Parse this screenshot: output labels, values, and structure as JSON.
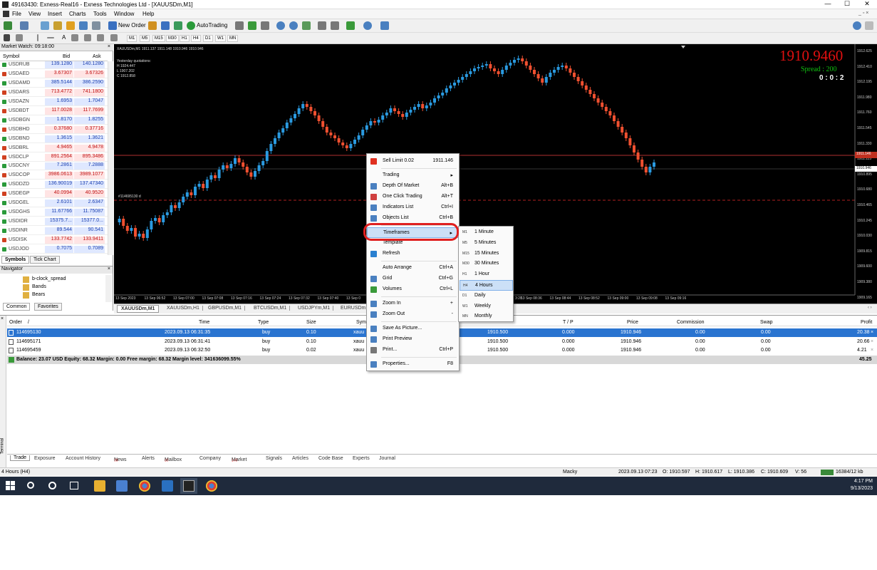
{
  "titlebar": {
    "title": "49163430: Exness-Real16 - Exness Technologies Ltd - [XAUUSDm,M1]",
    "min": "—",
    "max": "☐",
    "close": "✕"
  },
  "menu": [
    "File",
    "View",
    "Insert",
    "Charts",
    "Tools",
    "Window",
    "Help"
  ],
  "toolbar": {
    "new_order": "New Order",
    "autotrading": "AutoTrading"
  },
  "timeframes": [
    "M1",
    "M5",
    "M15",
    "M30",
    "H1",
    "H4",
    "D1",
    "W1",
    "MN"
  ],
  "market_watch": {
    "header": "Market Watch: 09:18:00",
    "col_symbol": "Symbol",
    "col_bid": "Bid",
    "col_ask": "Ask",
    "rows": [
      {
        "sym": "USDRUB",
        "bid": "139.1280",
        "ask": "140.1280",
        "dir": "up"
      },
      {
        "sym": "USDAED",
        "bid": "3.67307",
        "ask": "3.67326",
        "dir": "down"
      },
      {
        "sym": "USDAMD",
        "bid": "385.5144",
        "ask": "386.2590",
        "dir": "up"
      },
      {
        "sym": "USDARS",
        "bid": "713.4772",
        "ask": "741.1800",
        "dir": "down"
      },
      {
        "sym": "USDAZN",
        "bid": "1.6953",
        "ask": "1.7047",
        "dir": "up"
      },
      {
        "sym": "USDBDT",
        "bid": "117.0028",
        "ask": "117.7699",
        "dir": "down"
      },
      {
        "sym": "USDBGN",
        "bid": "1.8170",
        "ask": "1.8255",
        "dir": "up"
      },
      {
        "sym": "USDBHD",
        "bid": "0.37680",
        "ask": "0.37716",
        "dir": "down"
      },
      {
        "sym": "USDBND",
        "bid": "1.3615",
        "ask": "1.3621",
        "dir": "up"
      },
      {
        "sym": "USDBRL",
        "bid": "4.9465",
        "ask": "4.9478",
        "dir": "down"
      },
      {
        "sym": "USDCLP",
        "bid": "891.2564",
        "ask": "895.3486",
        "dir": "down"
      },
      {
        "sym": "USDCNY",
        "bid": "7.2861",
        "ask": "7.2888",
        "dir": "up"
      },
      {
        "sym": "USDCOP",
        "bid": "3986.0613",
        "ask": "3989.1077",
        "dir": "down"
      },
      {
        "sym": "USDDZD",
        "bid": "136.90019",
        "ask": "137.47340",
        "dir": "up"
      },
      {
        "sym": "USDEGP",
        "bid": "40.0994",
        "ask": "40.9520",
        "dir": "down"
      },
      {
        "sym": "USDGEL",
        "bid": "2.6101",
        "ask": "2.6347",
        "dir": "up"
      },
      {
        "sym": "USDGHS",
        "bid": "11.67766",
        "ask": "11.75087",
        "dir": "up"
      },
      {
        "sym": "USDIDR",
        "bid": "15375.7...",
        "ask": "15377.0...",
        "dir": "up"
      },
      {
        "sym": "USDINR",
        "bid": "89.544",
        "ask": "90.541",
        "dir": "up"
      },
      {
        "sym": "USDISK",
        "bid": "133.7742",
        "ask": "133.9411",
        "dir": "down"
      },
      {
        "sym": "USDJOD",
        "bid": "0.7075",
        "ask": "0.7089",
        "dir": "up"
      }
    ],
    "tab_symbols": "Symbols",
    "tab_tick": "Tick Chart"
  },
  "navigator": {
    "header": "Navigator",
    "items": [
      "b-clock_spread",
      "Bands",
      "Bears"
    ],
    "tab_common": "Common",
    "tab_favorites": "Favorites"
  },
  "chart": {
    "header": "XAUUSDm,M1  1911.137 1911.148 1910.946 1910.946",
    "yq": "Yesterday quotations:",
    "h": "H 1924.447",
    "l": "L 1907.202",
    "c": "C 1912.858",
    "big_price": "1910.9460",
    "spread": "Spread : 200",
    "timer": "0 : 0 : 2",
    "order_label": "#114695130 d",
    "price_axis": [
      "1912.625",
      "1912.410",
      "1912.195",
      "1911.980",
      "1911.760",
      "1911.545",
      "1911.330",
      "1911.115",
      "1910.895",
      "1910.680",
      "1910.465",
      "1910.245",
      "1910.030",
      "1909.815",
      "1909.600",
      "1909.380",
      "1909.165"
    ],
    "ask_line": "1911.146",
    "bid_line": "1910.946",
    "time_axis_left": [
      "13 Sep 2023",
      "13 Sep 06:52",
      "13 Sep 07:00",
      "13 Sep 07:08",
      "13 Sep 07:16",
      "13 Sep 07:24",
      "13 Sep 07:32",
      "13 Sep 07:40",
      "13 Sep 0"
    ],
    "time_axis_right": [
      "3:28",
      "13 Sep 08:36",
      "13 Sep 08:44",
      "13 Sep 08:52",
      "13 Sep 09:00",
      "13 Sep 09:08",
      "13 Sep 09:16"
    ]
  },
  "chart_tabs": [
    "XAUUSDm,M1",
    "XAUUSDm,H1",
    "GBPUSDm,M1",
    "BTCUSDm,M1",
    "USDJPYm,M1",
    "EURUSDm,"
  ],
  "context_menu": [
    {
      "label": "Sell Limit 0.02",
      "shortcut": "1911.146",
      "icon": "sell-limit"
    },
    {
      "sep": true
    },
    {
      "label": "Trading",
      "shortcut": "▸",
      "icon": ""
    },
    {
      "label": "Depth Of Market",
      "shortcut": "Alt+B",
      "icon": "dom"
    },
    {
      "label": "One Click Trading",
      "shortcut": "Alt+T",
      "icon": "oct"
    },
    {
      "label": "Indicators List",
      "shortcut": "Ctrl+I",
      "icon": "ind"
    },
    {
      "label": "Objects List",
      "shortcut": "Ctrl+B",
      "icon": "obj"
    },
    {
      "sep": true
    },
    {
      "label": "Timeframes",
      "shortcut": "▸",
      "icon": "",
      "active": true
    },
    {
      "label": "Template",
      "shortcut": "",
      "icon": ""
    },
    {
      "label": "Refresh",
      "shortcut": "",
      "icon": "refresh"
    },
    {
      "sep": true
    },
    {
      "label": "Auto Arrange",
      "shortcut": "Ctrl+A",
      "icon": ""
    },
    {
      "label": "Grid",
      "shortcut": "Ctrl+G",
      "icon": "grid"
    },
    {
      "label": "Volumes",
      "shortcut": "Ctrl+L",
      "icon": "vol"
    },
    {
      "sep": true
    },
    {
      "label": "Zoom In",
      "shortcut": "+",
      "icon": "zoomin"
    },
    {
      "label": "Zoom Out",
      "shortcut": "-",
      "icon": "zoomout"
    },
    {
      "sep": true
    },
    {
      "label": "Save As Picture...",
      "shortcut": "",
      "icon": "save"
    },
    {
      "label": "Print Preview",
      "shortcut": "",
      "icon": "preview"
    },
    {
      "label": "Print...",
      "shortcut": "Ctrl+P",
      "icon": "print"
    },
    {
      "sep": true
    },
    {
      "label": "Properties...",
      "shortcut": "F8",
      "icon": "props"
    }
  ],
  "timeframe_submenu": [
    {
      "code": "M1",
      "label": "1 Minute"
    },
    {
      "code": "M5",
      "label": "5 Minutes"
    },
    {
      "code": "M15",
      "label": "15 Minutes"
    },
    {
      "code": "M30",
      "label": "30 Minutes"
    },
    {
      "code": "H1",
      "label": "1 Hour"
    },
    {
      "code": "H4",
      "label": "4 Hours",
      "selected": true
    },
    {
      "code": "D1",
      "label": "Daily"
    },
    {
      "code": "W1",
      "label": "Weekly"
    },
    {
      "code": "MN",
      "label": "Monthly"
    }
  ],
  "terminal": {
    "headers": {
      "order": "Order",
      "sort": "/",
      "time": "Time",
      "type": "Type",
      "size": "Size",
      "symbol": "Sym",
      "sl": "S / L",
      "tp": "T / P",
      "price": "Price",
      "commission": "Commission",
      "swap": "Swap",
      "profit": "Profit"
    },
    "rows": [
      {
        "order": "114695130",
        "time": "2023.09.13 06:31:35",
        "type": "buy",
        "size": "0.10",
        "symbol": "xauu",
        "sl": "1910.500",
        "tp": "0.000",
        "price": "1910.946",
        "commission": "0.00",
        "swap": "0.00",
        "profit": "20.38",
        "selected": true
      },
      {
        "order": "114695171",
        "time": "2023.09.13 06:31:41",
        "type": "buy",
        "size": "0.10",
        "symbol": "xauu",
        "sl": "1910.500",
        "tp": "0.000",
        "price": "1910.946",
        "commission": "0.00",
        "swap": "0.00",
        "profit": "20.66"
      },
      {
        "order": "114695459",
        "time": "2023.09.13 06:32:50",
        "type": "buy",
        "size": "0.02",
        "symbol": "xauu",
        "sl": "1910.500",
        "tp": "0.000",
        "price": "1910.946",
        "commission": "0.00",
        "swap": "0.00",
        "profit": "4.21"
      }
    ],
    "balance": "Balance: 23.07 USD  Equity: 68.32  Margin: 0.00  Free margin: 68.32  Margin level: 341636099.55%",
    "total_profit": "45.25",
    "side_label": "Terminal",
    "tabs": [
      "Trade",
      "Exposure",
      "Account History",
      "News",
      "Alerts",
      "Mailbox",
      "Company",
      "Market",
      "Signals",
      "Articles",
      "Code Base",
      "Experts",
      "Journal"
    ],
    "badge_news": "99",
    "badge_mailbox": "89",
    "badge_market": "140"
  },
  "status": {
    "left": "4 Hours (H4)",
    "profile": "Macky",
    "datetime": "2023.09.13 07:23",
    "o": "O: 1910.597",
    "h": "H: 1910.617",
    "l": "L: 1910.386",
    "c": "C: 1910.609",
    "v": "V: 56",
    "mem": "16384/12 kb"
  },
  "taskbar": {
    "time": "4:17 PM",
    "date": "9/13/2023"
  },
  "chart_data": {
    "type": "candlestick",
    "series": [],
    "note": ""
  }
}
